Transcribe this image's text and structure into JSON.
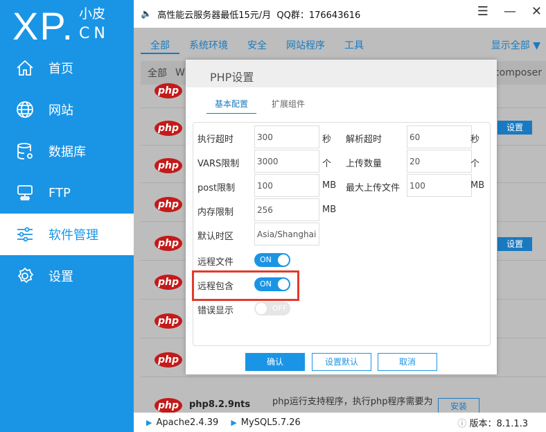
{
  "logo": {
    "brand": "XP.",
    "sub": "小皮",
    "cn": "CN"
  },
  "sidebar": {
    "items": [
      {
        "label": "首页",
        "icon": "home-icon"
      },
      {
        "label": "网站",
        "icon": "globe-icon"
      },
      {
        "label": "数据库",
        "icon": "database-icon"
      },
      {
        "label": "FTP",
        "icon": "ftp-icon"
      },
      {
        "label": "软件管理",
        "icon": "sliders-icon",
        "active": true
      },
      {
        "label": "设置",
        "icon": "gear-icon"
      }
    ]
  },
  "topbar": {
    "notice": "高性能云服务器最低15元/月  QQ群：176643616"
  },
  "tabs": [
    "全部",
    "系统环境",
    "安全",
    "网站程序",
    "工具"
  ],
  "show_all": "显示全部",
  "subhead": {
    "left": "全部",
    "left2": "W",
    "right": "composer"
  },
  "row": {
    "logo_text": "php",
    "set_label": "设置"
  },
  "last_row": {
    "name": "php8.2.9nts",
    "desc": "php运行支持程序，执行php程序需要为",
    "install": "安装"
  },
  "dialog": {
    "title": "PHP设置",
    "tabs": [
      "基本配置",
      "扩展组件"
    ],
    "fields": {
      "exec_timeout": {
        "label": "执行超时",
        "value": "300",
        "unit": "秒"
      },
      "parse_timeout": {
        "label": "解析超时",
        "value": "60",
        "unit": "秒"
      },
      "vars_limit": {
        "label": "VARS限制",
        "value": "3000",
        "unit": "个"
      },
      "upload_count": {
        "label": "上传数量",
        "value": "20",
        "unit": "个"
      },
      "post_limit": {
        "label": "post限制",
        "value": "100",
        "unit": "MB"
      },
      "max_upload": {
        "label": "最大上传文件",
        "value": "100",
        "unit": "MB"
      },
      "memory_limit": {
        "label": "内存限制",
        "value": "256",
        "unit": "MB"
      },
      "timezone": {
        "label": "默认时区",
        "value": "Asia/Shanghai"
      }
    },
    "toggles": {
      "remote_file": {
        "label": "远程文件",
        "state": "ON"
      },
      "remote_include": {
        "label": "远程包含",
        "state": "ON"
      },
      "error_display": {
        "label": "错误显示",
        "state": "OFF"
      }
    },
    "buttons": {
      "ok": "确认",
      "default": "设置默认",
      "cancel": "取消"
    }
  },
  "footer": {
    "apache": "Apache2.4.39",
    "mysql": "MySQL5.7.26",
    "version": "版本：8.1.1.3"
  }
}
